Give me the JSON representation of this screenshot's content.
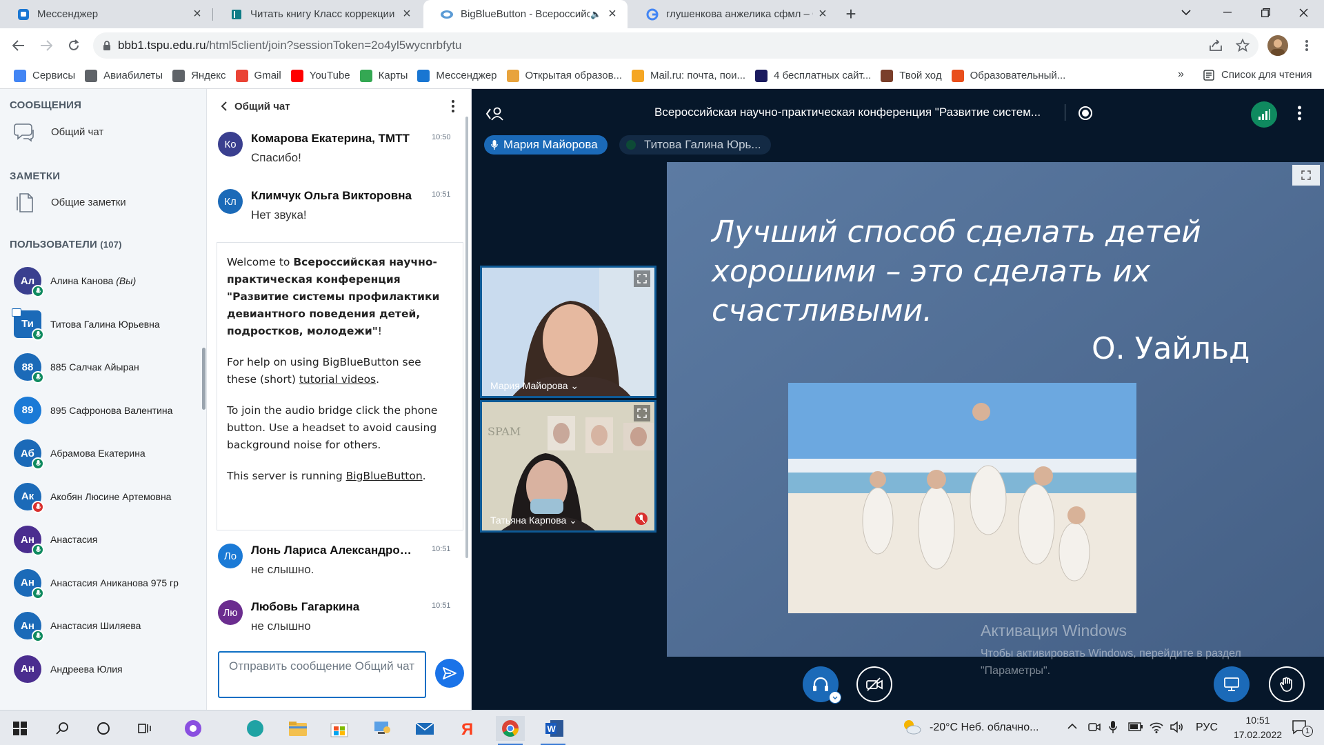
{
  "browser": {
    "tabs": [
      {
        "title": "Мессенджер",
        "icon": "messenger-icon"
      },
      {
        "title": "Читать книгу Класс коррекции",
        "icon": "book-icon"
      },
      {
        "title": "BigBlueButton - Всероссийс",
        "icon": "bigbluebutton-icon"
      },
      {
        "title": "глушенкова анжелика сфмл – G",
        "icon": "google-icon"
      }
    ],
    "url_host": "bbb1.tspu.edu.ru",
    "url_path": "/html5client/join?sessionToken=2o4yl5wycnrbfytu",
    "bookmarks": [
      {
        "label": "Сервисы",
        "icon": "apps-grid-icon",
        "color": "#4285f4"
      },
      {
        "label": "Авиабилеты",
        "icon": "globe-icon",
        "color": "#5f6368"
      },
      {
        "label": "Яндекс",
        "icon": "globe-icon",
        "color": "#5f6368"
      },
      {
        "label": "Gmail",
        "icon": "google-g-icon",
        "color": "#ea4335"
      },
      {
        "label": "YouTube",
        "icon": "youtube-icon",
        "color": "#ff0000"
      },
      {
        "label": "Карты",
        "icon": "maps-icon",
        "color": "#34a853"
      },
      {
        "label": "Мессенджер",
        "icon": "messenger-icon",
        "color": "#1976d2"
      },
      {
        "label": "Открытая образов...",
        "icon": "globe-icon",
        "color": "#e8a33c"
      },
      {
        "label": "Mail.ru: почта, пои...",
        "icon": "mailru-icon",
        "color": "#f5a623"
      },
      {
        "label": "4 бесплатных сайт...",
        "icon": "nr-icon",
        "color": "#1a1a5e"
      },
      {
        "label": "Твой ход",
        "icon": "globe-icon",
        "color": "#7a3e2a"
      },
      {
        "label": "Образовательный...",
        "icon": "globe-icon",
        "color": "#e94e1b"
      }
    ],
    "bookmarks_more": "»",
    "reading_list": "Список для чтения"
  },
  "sidebar": {
    "messages_header": "СООБЩЕНИЯ",
    "public_chat": "Общий чат",
    "notes_header": "ЗАМЕТКИ",
    "shared_notes": "Общие заметки",
    "users_header": "ПОЛЬЗОВАТЕЛИ",
    "users_count": "(107)",
    "users": [
      {
        "initials": "Ал",
        "name": "Алина Канова",
        "suffix": "(Вы)",
        "color": "#3a3f8f",
        "mic": "on",
        "presenter": false
      },
      {
        "initials": "Ти",
        "name": "Титова Галина Юрьевна",
        "suffix": "",
        "color": "#1b6ab8",
        "mic": "on",
        "presenter": true
      },
      {
        "initials": "88",
        "name": "885 Салчак Айыран",
        "suffix": "",
        "color": "#1b6ab8",
        "mic": "on",
        "presenter": false
      },
      {
        "initials": "89",
        "name": "895 Сафронова Валентина",
        "suffix": "",
        "color": "#1b7ad6",
        "mic": "none",
        "presenter": false
      },
      {
        "initials": "Аб",
        "name": "Абрамова Екатерина",
        "suffix": "",
        "color": "#1b6ab8",
        "mic": "on",
        "presenter": false
      },
      {
        "initials": "Ак",
        "name": "Акобян Люсине Артемовна",
        "suffix": "",
        "color": "#1b6ab8",
        "mic": "muted",
        "presenter": false
      },
      {
        "initials": "Ан",
        "name": "Анастасия",
        "suffix": "",
        "color": "#4a2d8f",
        "mic": "on",
        "presenter": false
      },
      {
        "initials": "Ан",
        "name": "Анастасия Аниканова 975 гр",
        "suffix": "",
        "color": "#1b6ab8",
        "mic": "on",
        "presenter": false
      },
      {
        "initials": "Ан",
        "name": "Анастасия Шиляева",
        "suffix": "",
        "color": "#1b6ab8",
        "mic": "on",
        "presenter": false
      },
      {
        "initials": "Ан",
        "name": "Андреева Юлия",
        "suffix": "",
        "color": "#4a2d8f",
        "mic": "none",
        "presenter": false
      }
    ]
  },
  "chat": {
    "title": "Общий чат",
    "messages_top": [
      {
        "initials": "Ко",
        "name": "Комарова Екатерина, ТМТТ",
        "time": "10:50",
        "text": "Спасибо!",
        "color": "#3a3f8f"
      },
      {
        "initials": "Кл",
        "name": "Климчук Ольга Викторовна",
        "time": "10:51",
        "text": "Нет звука!",
        "color": "#1b6ab8"
      }
    ],
    "welcome": {
      "prefix": "Welcome to ",
      "conference": "Всероссийская научно-практическая конференция \"Развитие системы профилактики девиантного поведения детей, подростков, молодежи\"",
      "suffix": "!",
      "help_prefix": "For help on using BigBlueButton see these (short) ",
      "help_link": "tutorial videos",
      "help_suffix": ".",
      "audio": "To join the audio bridge click the phone button. Use a headset to avoid causing background noise for others.",
      "server_prefix": "This server is running ",
      "server_link": "BigBlueButton",
      "server_suffix": "."
    },
    "messages_bottom": [
      {
        "initials": "Ло",
        "name": "Лонь Лариса Александровна",
        "time": "10:51",
        "text": "не слышно.",
        "color": "#1b7ad6"
      },
      {
        "initials": "Лю",
        "name": "Любовь Гагаркина",
        "time": "10:51",
        "text": "не слышно",
        "color": "#6b2d8f"
      }
    ],
    "input_placeholder": "Отправить сообщение Общий чат"
  },
  "meeting": {
    "title": "Всероссийская научно-практическая конференция \"Развитие систем...",
    "speakers": [
      {
        "name": "Мария Майорова",
        "active": true
      },
      {
        "name": "Титова Галина Юрь...",
        "active": false
      }
    ],
    "videos": [
      {
        "name": "Мария Майорова",
        "muted": false
      },
      {
        "name": "Татьяна Карпова",
        "muted": true
      }
    ],
    "slide": {
      "quote": "Лучший способ сделать детей\nхорошими – это сделать их\nсчастливыми.",
      "author": "О. Уайльд"
    },
    "watermark_title": "Активация Windows",
    "watermark_text": "Чтобы активировать Windows, перейдите в раздел\n\"Параметры\"."
  },
  "taskbar": {
    "weather": "-20°C  Неб. облачно...",
    "lang": "РУС",
    "time": "10:51",
    "date": "17.02.2022",
    "notifications": "1"
  },
  "colors": {
    "accent": "#1a73e8",
    "bbb_dark": "#06172a",
    "mic_on": "#0f8a5f",
    "mic_muted": "#d9302e"
  }
}
